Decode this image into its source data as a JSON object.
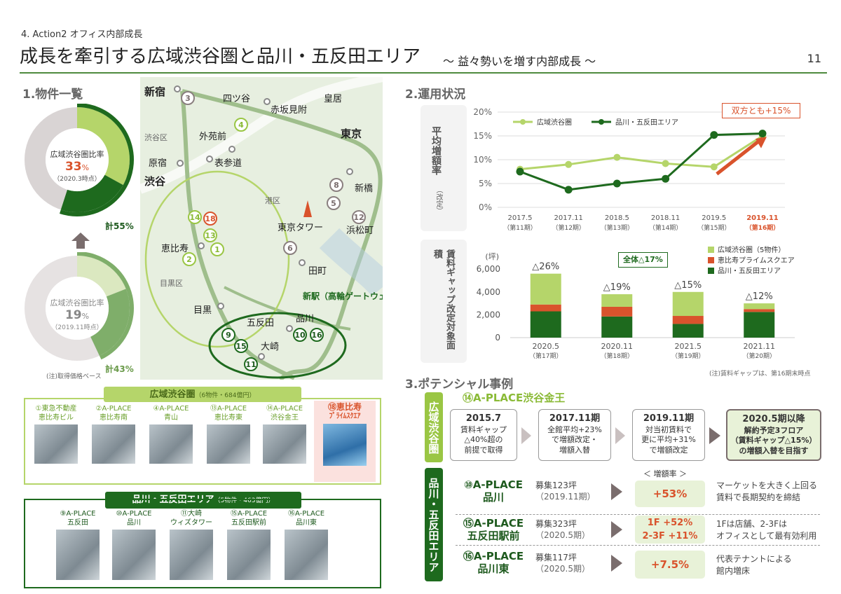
{
  "header": {
    "subtitle": "4. Action2 オフィス内部成長",
    "title": "成長を牽引する広域渋谷圏と品川・五反田エリア",
    "title_suffix": "～ 益々勢いを増す内部成長 ～",
    "page_number": "11"
  },
  "section1": {
    "heading": "1.物件一覧",
    "donut_top": {
      "label": "広域渋谷圏比率",
      "value": "33",
      "unit": "%",
      "date": "（2020.3時点）",
      "total": "計55%",
      "share_pct": 33,
      "total_pct": 55
    },
    "donut_bottom": {
      "label": "広域渋谷圏比率",
      "value": "19",
      "unit": "%",
      "date": "（2019.11時点）",
      "total": "計43%",
      "share_pct": 19,
      "total_pct": 43
    },
    "note": "(注)取得価格ベース"
  },
  "map": {
    "labels": {
      "shinjuku": "新宿",
      "yotsuya": "四ツ谷",
      "kokyo": "皇居",
      "akasaka": "赤坂見附",
      "tokyo": "東京",
      "shibuyaku": "渋谷区",
      "gaien": "外苑前",
      "harajuku": "原宿",
      "omotesando": "表参道",
      "shibuya": "渋谷",
      "minatoku": "港区",
      "shinbashi": "新橋",
      "tower": "東京タワー",
      "hamamatsu": "浜松町",
      "ebisu": "恵比寿",
      "tamachi": "田町",
      "meguroku": "目黒区",
      "newst": "新駅（高輪ゲートウェイ）",
      "meguro": "目黒",
      "gotanda": "五反田",
      "shinagawa": "品川",
      "osaki": "大崎"
    },
    "markers": {
      "m1": "1",
      "m2": "2",
      "m3": "3",
      "m4": "4",
      "m5": "5",
      "m6": "6",
      "m8": "8",
      "m9": "9",
      "m10": "10",
      "m11": "11",
      "m12": "12",
      "m13": "13",
      "m14": "14",
      "m15": "15",
      "m16": "16",
      "m18": "18"
    }
  },
  "shibuya_panel": {
    "title": "広域渋谷圏",
    "title_note": "（6物件・684億円）",
    "buildings": [
      {
        "line1": "①東急不動産",
        "line2": "恵比寿ビル"
      },
      {
        "line1": "②A-PLACE",
        "line2": "恵比寿南"
      },
      {
        "line1": "④A-PLACE",
        "line2": "青山"
      },
      {
        "line1": "⑬A-PLACE",
        "line2": "恵比寿東"
      },
      {
        "line1": "⑭A-PLACE",
        "line2": "渋谷金王"
      },
      {
        "line1": "⑱恵比寿",
        "line2": "ﾌﾟﾗｲﾑｽｸｴｱ"
      }
    ]
  },
  "shinagawa_panel": {
    "title": "品川・五反田エリア",
    "title_note": "（5物件・463億円）",
    "buildings": [
      {
        "line1": "⑨A-PLACE",
        "line2": "五反田"
      },
      {
        "line1": "⑩A-PLACE",
        "line2": "品川"
      },
      {
        "line1": "⑪大崎",
        "line2": "ウィズタワー"
      },
      {
        "line1": "⑮A-PLACE",
        "line2": "五反田駅前"
      },
      {
        "line1": "⑯A-PLACE",
        "line2": "品川東"
      }
    ]
  },
  "section2": {
    "heading": "2.運用状況",
    "line_ylabel": "平均増額率",
    "line_ylabel_note": "（改定）",
    "callout": "双方とも+15%",
    "bar_ylabel": "賃料ギャップ改定対象面積",
    "bar_unit": "(坪)",
    "bar_total_badge": "全体△17%",
    "bar_note": "(注)賃料ギャップは、第16期末時点"
  },
  "chart_data": [
    {
      "type": "line",
      "categories": [
        "2017.5",
        "2017.11",
        "2018.5",
        "2018.11",
        "2019.5",
        "2019.11"
      ],
      "category_sub": [
        "（第11期）",
        "（第12期）",
        "（第13期）",
        "（第14期）",
        "（第15期）",
        "（第16期）"
      ],
      "series": [
        {
          "name": "広域渋谷圏",
          "values": [
            8,
            9,
            10.5,
            9.2,
            8.5,
            15
          ],
          "color": "#b5d56a"
        },
        {
          "name": "品川・五反田エリア",
          "values": [
            7.5,
            3.7,
            5,
            6,
            15.2,
            15.5
          ],
          "color": "#1e6a1e"
        }
      ],
      "yticks": [
        "0%",
        "5%",
        "10%",
        "15%",
        "20%"
      ],
      "ylim": [
        0,
        20
      ]
    },
    {
      "type": "bar",
      "categories": [
        "2020.5",
        "2020.11",
        "2021.5",
        "2021.11"
      ],
      "category_sub": [
        "（第17期）",
        "（第18期）",
        "（第19期）",
        "（第20期）"
      ],
      "series": [
        {
          "name": "品川・五反田エリア",
          "values": [
            2300,
            1850,
            1200,
            2250
          ],
          "color": "#1e6a1e"
        },
        {
          "name": "恵比寿プライムスクエア",
          "values": [
            600,
            850,
            700,
            250
          ],
          "color": "#d9532c"
        },
        {
          "name": "広域渋谷圏（5物件）",
          "values": [
            2700,
            1100,
            2100,
            500
          ],
          "color": "#b5d56a"
        }
      ],
      "bar_labels": [
        "△26%",
        "△19%",
        "△15%",
        "△12%"
      ],
      "yticks": [
        "0",
        "2,000",
        "4,000",
        "6,000"
      ],
      "ylim": [
        0,
        6500
      ]
    }
  ],
  "section3": {
    "heading": "3.ポテンシャル事例",
    "shibuya_tag": "広域渋谷圏",
    "shinagawa_tag": "品川・五反田エリア",
    "case_title": "⑭A-PLACE渋谷金王",
    "steps": [
      {
        "title": "2015.7",
        "l1": "賃料ギャップ",
        "l2": "△40%超の",
        "l3": "前提で取得"
      },
      {
        "title": "2017.11期",
        "l1": "全館平均+23%",
        "l2": "で増額改定・",
        "l3": "増額入替"
      },
      {
        "title": "2019.11期",
        "l1": "対当初賃料で",
        "l2": "更に平均+31%",
        "l3": "で増額改定"
      },
      {
        "title": "2020.5期以降",
        "l1": "解約予定3フロア",
        "l2": "（賃料ギャップ△15%）",
        "l3": "の増額入替を目指す"
      }
    ],
    "rate_header": "＜ 増額率 ＞",
    "rows": [
      {
        "name1": "⑩A-PLACE",
        "name2": "品川",
        "info1": "募集123坪",
        "info2": "（2019.11期）",
        "rate1": "+53%",
        "rate2": "",
        "desc1": "マーケットを大きく上回る",
        "desc2": "賃料で長期契約を締結"
      },
      {
        "name1": "⑮A-PLACE",
        "name2": "五反田駅前",
        "info1": "募集323坪",
        "info2": "（2020.5期）",
        "rate1": "1F +52%",
        "rate2": "2-3F +11%",
        "desc1": "1Fは店舗、2-3Fは",
        "desc2": "オフィスとして最有効利用"
      },
      {
        "name1": "⑯A-PLACE",
        "name2": "品川東",
        "info1": "募集117坪",
        "info2": "（2020.5期）",
        "rate1": "+7.5%",
        "rate2": "",
        "desc1": "代表テナントによる",
        "desc2": "館内増床"
      }
    ]
  }
}
